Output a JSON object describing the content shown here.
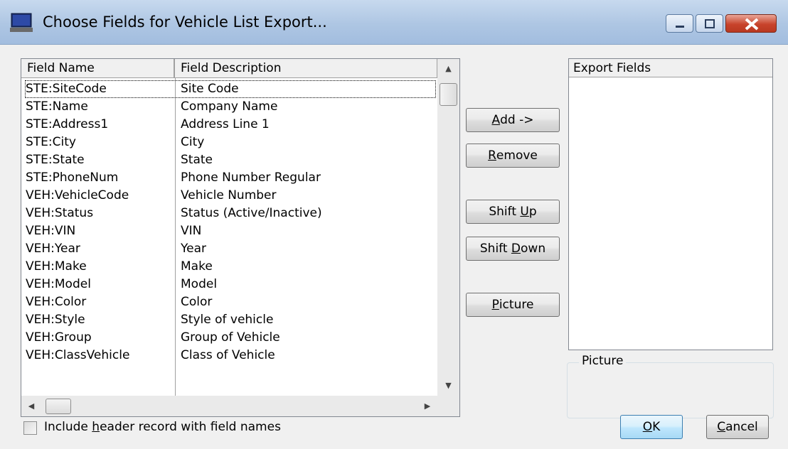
{
  "window": {
    "title": "Choose Fields for Vehicle List Export...",
    "icon": "computer-icon",
    "controls": [
      "minimize-icon",
      "maximize-icon",
      "close-icon"
    ]
  },
  "field_list": {
    "columns": [
      "Field Name",
      "Field Description"
    ],
    "rows": [
      {
        "name": "STE:SiteCode",
        "desc": "Site Code"
      },
      {
        "name": "STE:Name",
        "desc": "Company Name"
      },
      {
        "name": "STE:Address1",
        "desc": "Address Line 1"
      },
      {
        "name": "STE:City",
        "desc": "City"
      },
      {
        "name": "STE:State",
        "desc": "State"
      },
      {
        "name": "STE:PhoneNum",
        "desc": "Phone Number Regular"
      },
      {
        "name": "VEH:VehicleCode",
        "desc": "Vehicle Number"
      },
      {
        "name": "VEH:Status",
        "desc": "Status (Active/Inactive)"
      },
      {
        "name": "VEH:VIN",
        "desc": "VIN"
      },
      {
        "name": "VEH:Year",
        "desc": "Year"
      },
      {
        "name": "VEH:Make",
        "desc": "Make"
      },
      {
        "name": "VEH:Model",
        "desc": "Model"
      },
      {
        "name": "VEH:Color",
        "desc": "Color"
      },
      {
        "name": "VEH:Style",
        "desc": "Style of vehicle"
      },
      {
        "name": "VEH:Group",
        "desc": "Group of Vehicle"
      },
      {
        "name": "VEH:ClassVehicle",
        "desc": "Class of Vehicle"
      }
    ]
  },
  "buttons": {
    "add": {
      "pre": "",
      "key": "A",
      "post": "dd ->"
    },
    "remove": {
      "pre": "",
      "key": "R",
      "post": "emove"
    },
    "shift_up": {
      "pre": "Shift ",
      "key": "U",
      "post": "p"
    },
    "shift_down": {
      "pre": "Shift ",
      "key": "D",
      "post": "own"
    },
    "picture": {
      "pre": "",
      "key": "P",
      "post": "icture"
    },
    "ok": {
      "pre": "",
      "key": "O",
      "post": "K"
    },
    "cancel": {
      "pre": "",
      "key": "C",
      "post": "ancel"
    }
  },
  "export_fields": {
    "header": "Export Fields",
    "items": []
  },
  "picture_group": {
    "label": "Picture",
    "value": ""
  },
  "header_checkbox": {
    "pre": "Include ",
    "key": "h",
    "post": "eader record with field names",
    "checked": false
  },
  "colors": {
    "titlebar": "#aec6e3",
    "close_button": "#c8442c",
    "default_button_border": "#3c7fb1"
  }
}
